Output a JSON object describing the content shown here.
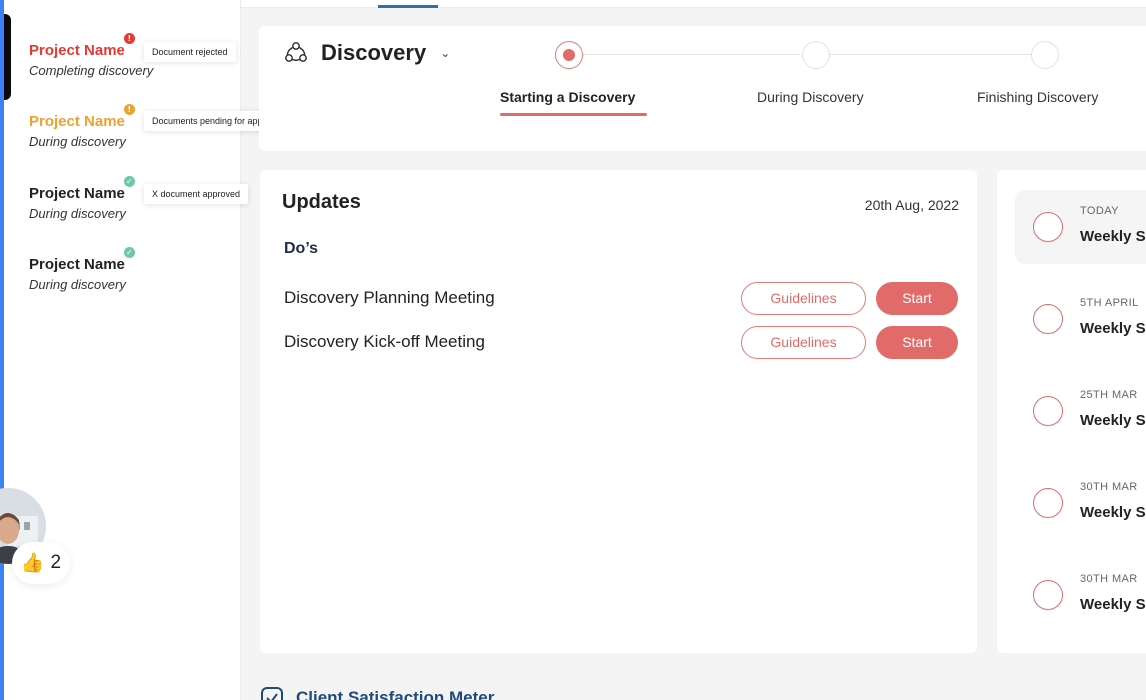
{
  "sidebar": {
    "projects": [
      {
        "name": "Project Name",
        "status": "Completing discovery",
        "tooltip": "Document rejected",
        "badge_glyph": "!",
        "color": "#e53935"
      },
      {
        "name": "Project Name",
        "status": "During discovery",
        "tooltip": "Documents pending for approval",
        "badge_glyph": "!",
        "color": "#f0a030"
      },
      {
        "name": "Project Name",
        "status": "During discovery",
        "tooltip": "X document approved",
        "badge_glyph": "✓",
        "color": "#6cc9a6"
      },
      {
        "name": "Project Name",
        "status": "During discovery",
        "tooltip": "",
        "badge_glyph": "✓",
        "color": "#6cc9a6"
      }
    ],
    "reaction": {
      "emoji": "👍",
      "count": "2"
    }
  },
  "stage": {
    "title": "Discovery",
    "steps": [
      {
        "label": "Starting a Discovery",
        "active": true
      },
      {
        "label": "During Discovery",
        "active": false
      },
      {
        "label": "Finishing Discovery",
        "active": false
      }
    ]
  },
  "updates": {
    "title": "Updates",
    "date": "20th Aug, 2022",
    "section_title": "Do’s",
    "tasks": [
      {
        "name": "Discovery Planning Meeting",
        "secondary": "Guidelines",
        "primary": "Start"
      },
      {
        "name": "Discovery Kick-off Meeting",
        "secondary": "Guidelines",
        "primary": "Start"
      }
    ]
  },
  "timeline": [
    {
      "date": "TODAY",
      "text": "Weekly S"
    },
    {
      "date": "5TH APRIL",
      "text": "Weekly S"
    },
    {
      "date": "25TH MAR",
      "text": "Weekly S"
    },
    {
      "date": "30TH MAR",
      "text": "Weekly S"
    },
    {
      "date": "30TH MAR",
      "text": "Weekly S"
    }
  ],
  "footer": {
    "title": "Client Satisfaction Meter"
  },
  "colors": {
    "accent": "#e06b69",
    "brand_blue": "#2f6fab",
    "text_navy": "#1f2d4a"
  }
}
